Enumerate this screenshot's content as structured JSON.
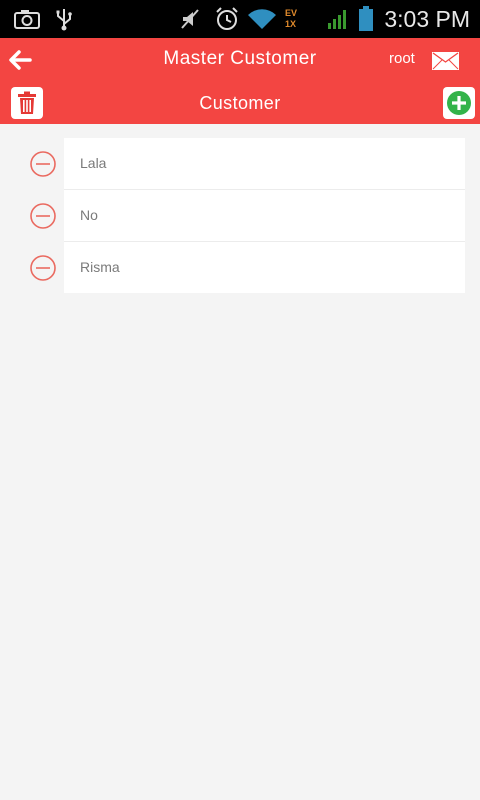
{
  "status_bar": {
    "time": "3:03 PM",
    "icons": [
      "camera-icon",
      "usb-icon",
      "mute-icon",
      "alarm-icon",
      "wifi-icon",
      "ev-signal-icon",
      "cell-signal-icon",
      "battery-icon"
    ],
    "network_label_top": "EV",
    "network_label_bottom": "1X"
  },
  "header": {
    "title": "Master Customer",
    "user": "root",
    "back_icon": "arrow-left-icon",
    "mail_icon": "envelope-icon"
  },
  "subheader": {
    "title": "Customer",
    "delete_icon": "trash-icon",
    "add_icon": "plus-circle-icon"
  },
  "customers": [
    {
      "name": "Lala"
    },
    {
      "name": "No"
    },
    {
      "name": "Risma"
    }
  ],
  "colors": {
    "accent": "#f34542",
    "add_green": "#33b34a",
    "remove_red": "#ea6a60"
  }
}
